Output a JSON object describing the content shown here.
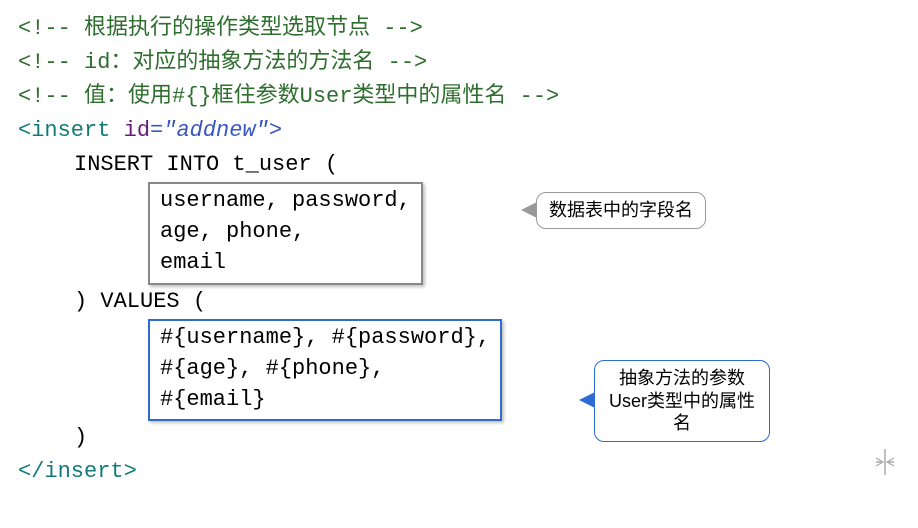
{
  "comment1_open": "<!--",
  "comment1_text": " 根据执行的操作类型选取节点 ",
  "comment1_close": "-->",
  "comment2_open": "<!--",
  "comment2_text": " id：对应的抽象方法的方法名 ",
  "comment2_close": "-->",
  "comment3_open": "<!--",
  "comment3_text": " 值：使用#{}框住参数User类型中的属性名 ",
  "comment3_close": "-->",
  "open_tag_lt": "<",
  "open_tag_name": "insert",
  "attr_name": "id",
  "eq_quote_open": "=\"",
  "attr_value": "addnew",
  "quote_close_gt": "\">",
  "sql_line1": "INSERT INTO t_user (",
  "box1_text": "username, password,\nage, phone,\nemail",
  "sql_line2": ") VALUES (",
  "box2_text": "#{username}, #{password},\n#{age}, #{phone},\n#{email}",
  "sql_line3": ")",
  "close_tag_lt": "</",
  "close_tag_name": "insert",
  "close_tag_gt": ">",
  "bubble1_text": "数据表中的字段名",
  "bubble2_text": "抽象方法的参数User类型中的属性名"
}
